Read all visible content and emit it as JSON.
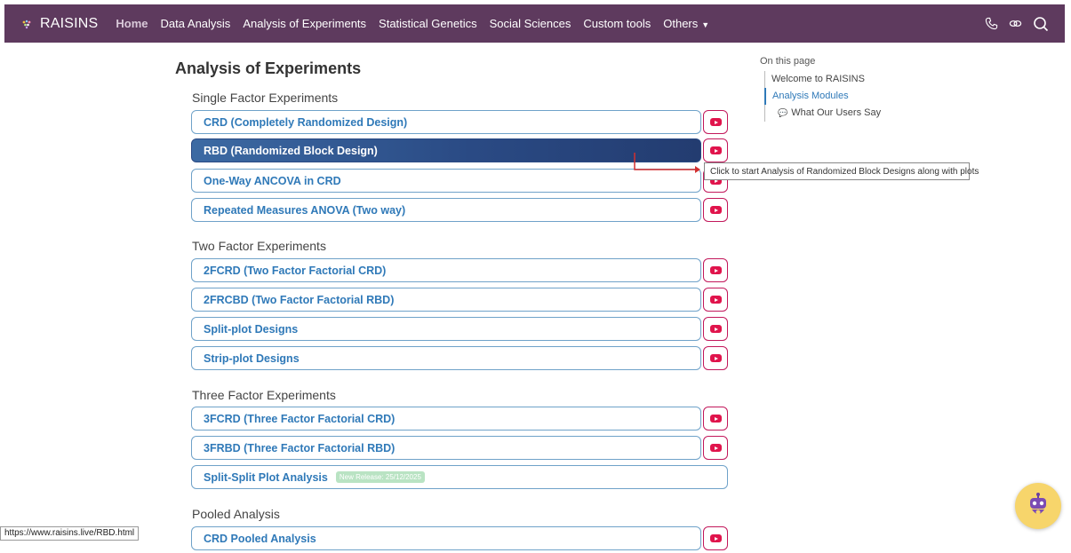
{
  "navbar": {
    "brand": "RAISINS",
    "items": [
      {
        "label": "Home",
        "active": true
      },
      {
        "label": "Data Analysis"
      },
      {
        "label": "Analysis of Experiments"
      },
      {
        "label": "Statistical Genetics"
      },
      {
        "label": "Social Sciences"
      },
      {
        "label": "Custom tools"
      },
      {
        "label": "Others"
      }
    ],
    "right_icons": [
      "phone-icon",
      "link-icon",
      "search-icon"
    ],
    "colors": {
      "background": "#5e3a5e"
    }
  },
  "main": {
    "title": "Analysis of Experiments",
    "sections": [
      {
        "title": "Single Factor Experiments",
        "modules": [
          {
            "label": "CRD (Completely Randomized Design)",
            "video": true
          },
          {
            "label": "RBD (Randomized Block Design)",
            "video": true,
            "active": true
          },
          {
            "label": "One-Way ANCOVA in CRD",
            "video": true
          },
          {
            "label": "Repeated Measures ANOVA (Two way)",
            "video": true
          }
        ]
      },
      {
        "title": "Two Factor Experiments",
        "modules": [
          {
            "label": "2FCRD (Two Factor Factorial CRD)",
            "video": true
          },
          {
            "label": "2FRCBD (Two Factor Factorial RBD)",
            "video": true
          },
          {
            "label": "Split-plot Designs",
            "video": true
          },
          {
            "label": "Strip-plot Designs",
            "video": true
          }
        ]
      },
      {
        "title": "Three Factor Experiments",
        "modules": [
          {
            "label": "3FCRD (Three Factor Factorial CRD)",
            "video": true
          },
          {
            "label": "3FRBD (Three Factor Factorial RBD)",
            "video": true
          },
          {
            "label": "Split-Split Plot Analysis",
            "video": false,
            "badge": "New Release: 25/12/2025"
          }
        ]
      },
      {
        "title": "Pooled Analysis",
        "modules": [
          {
            "label": "CRD Pooled Analysis",
            "video": true
          }
        ]
      }
    ]
  },
  "tooltip": {
    "text": "Click to start Analysis of Randomized Block Designs along with plots"
  },
  "toc": {
    "title": "On this page",
    "items": [
      {
        "label": "Welcome to RAISINS"
      },
      {
        "label": "Analysis Modules",
        "active": true
      },
      {
        "label": "What Our Users Say",
        "sub": true
      }
    ]
  },
  "statusbar": {
    "url": "https://www.raisins.live/RBD.html"
  },
  "colors": {
    "accent": "#2f79b8",
    "video": "#e0144c",
    "active_gradient_start": "#3c6aa3",
    "active_gradient_end": "#233c70"
  }
}
